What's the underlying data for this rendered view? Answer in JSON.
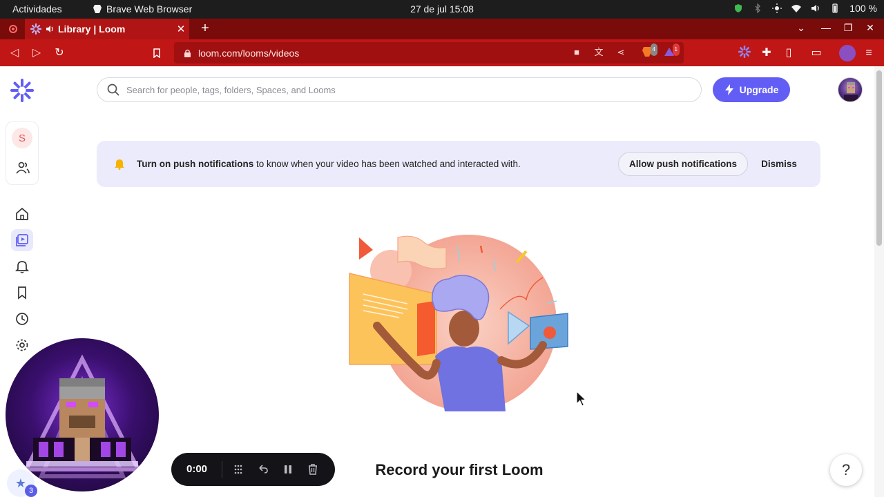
{
  "os": {
    "activities": "Actividades",
    "app_name": "Brave Web Browser",
    "clock": "27 de jul  15:08",
    "battery": "100 %"
  },
  "browser": {
    "tab_title": "Library | Loom",
    "url": "loom.com/looms/videos",
    "brave_badge": "4",
    "alert_badge": "1"
  },
  "header": {
    "search_placeholder": "Search for people, tags, folders, Spaces, and Looms",
    "upgrade_label": "Upgrade"
  },
  "sidebar": {
    "workspace_initial": "S"
  },
  "banner": {
    "bold_text": "Turn on push notifications",
    "text": " to know when your video has been watched and interacted with.",
    "allow_label": "Allow push notifications",
    "dismiss_label": "Dismiss"
  },
  "main": {
    "heading": "Record your first Loom"
  },
  "recorder": {
    "time": "0:00",
    "extension_count": "3"
  },
  "help": {
    "label": "?"
  },
  "colors": {
    "brand": "#625df5",
    "browser_red": "#c01616",
    "banner_bg": "#ebebfb"
  }
}
